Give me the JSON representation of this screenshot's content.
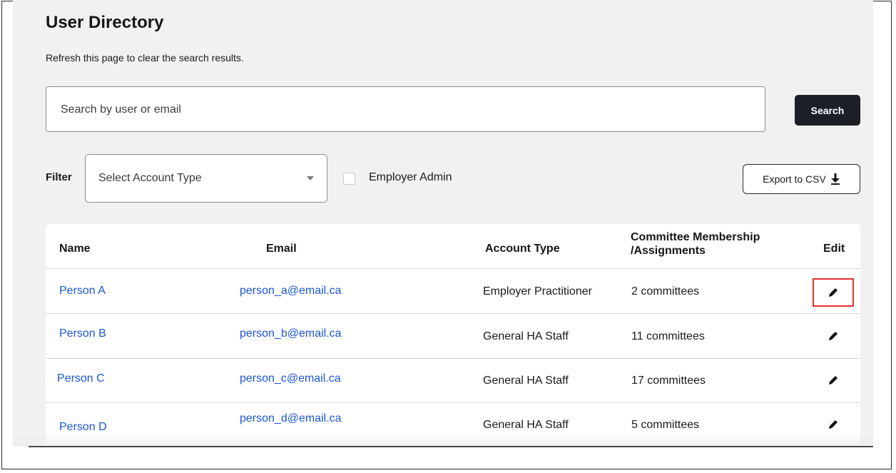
{
  "page": {
    "title": "User Directory",
    "subtitle": "Refresh this page to clear the search results."
  },
  "search": {
    "placeholder": "Search by user or email",
    "value": "",
    "button_label": "Search"
  },
  "filter": {
    "label": "Filter",
    "select_placeholder": "Select Account Type",
    "checkbox_label": "Employer Admin",
    "checkbox_checked": false,
    "export_label": "Export to CSV"
  },
  "table": {
    "headers": {
      "name": "Name",
      "email": "Email",
      "account_type": "Account Type",
      "committee_line1": "Committee Membership",
      "committee_line2": "/Assignments",
      "edit": "Edit"
    },
    "rows": [
      {
        "name": "Person A",
        "email": "person_a@email.ca",
        "account_type": "Employer Practitioner",
        "committees": "2 committees"
      },
      {
        "name": "Person B",
        "email": "person_b@email.ca",
        "account_type": "General HA Staff",
        "committees": "11 committees"
      },
      {
        "name": "Person C",
        "email": "person_c@email.ca",
        "account_type": "General HA Staff",
        "committees": "17 committees"
      },
      {
        "name": "Person D",
        "email": "person_d@email.ca",
        "account_type": "General HA Staff",
        "committees": "5 committees"
      }
    ]
  },
  "colors": {
    "link": "#1a56db",
    "primary_button": "#1c1f26",
    "highlight": "#e03131",
    "panel_bg": "#f1f1f1"
  },
  "icons": {
    "edit": "pencil-icon",
    "export": "download-icon",
    "select": "chevron-down-icon"
  }
}
